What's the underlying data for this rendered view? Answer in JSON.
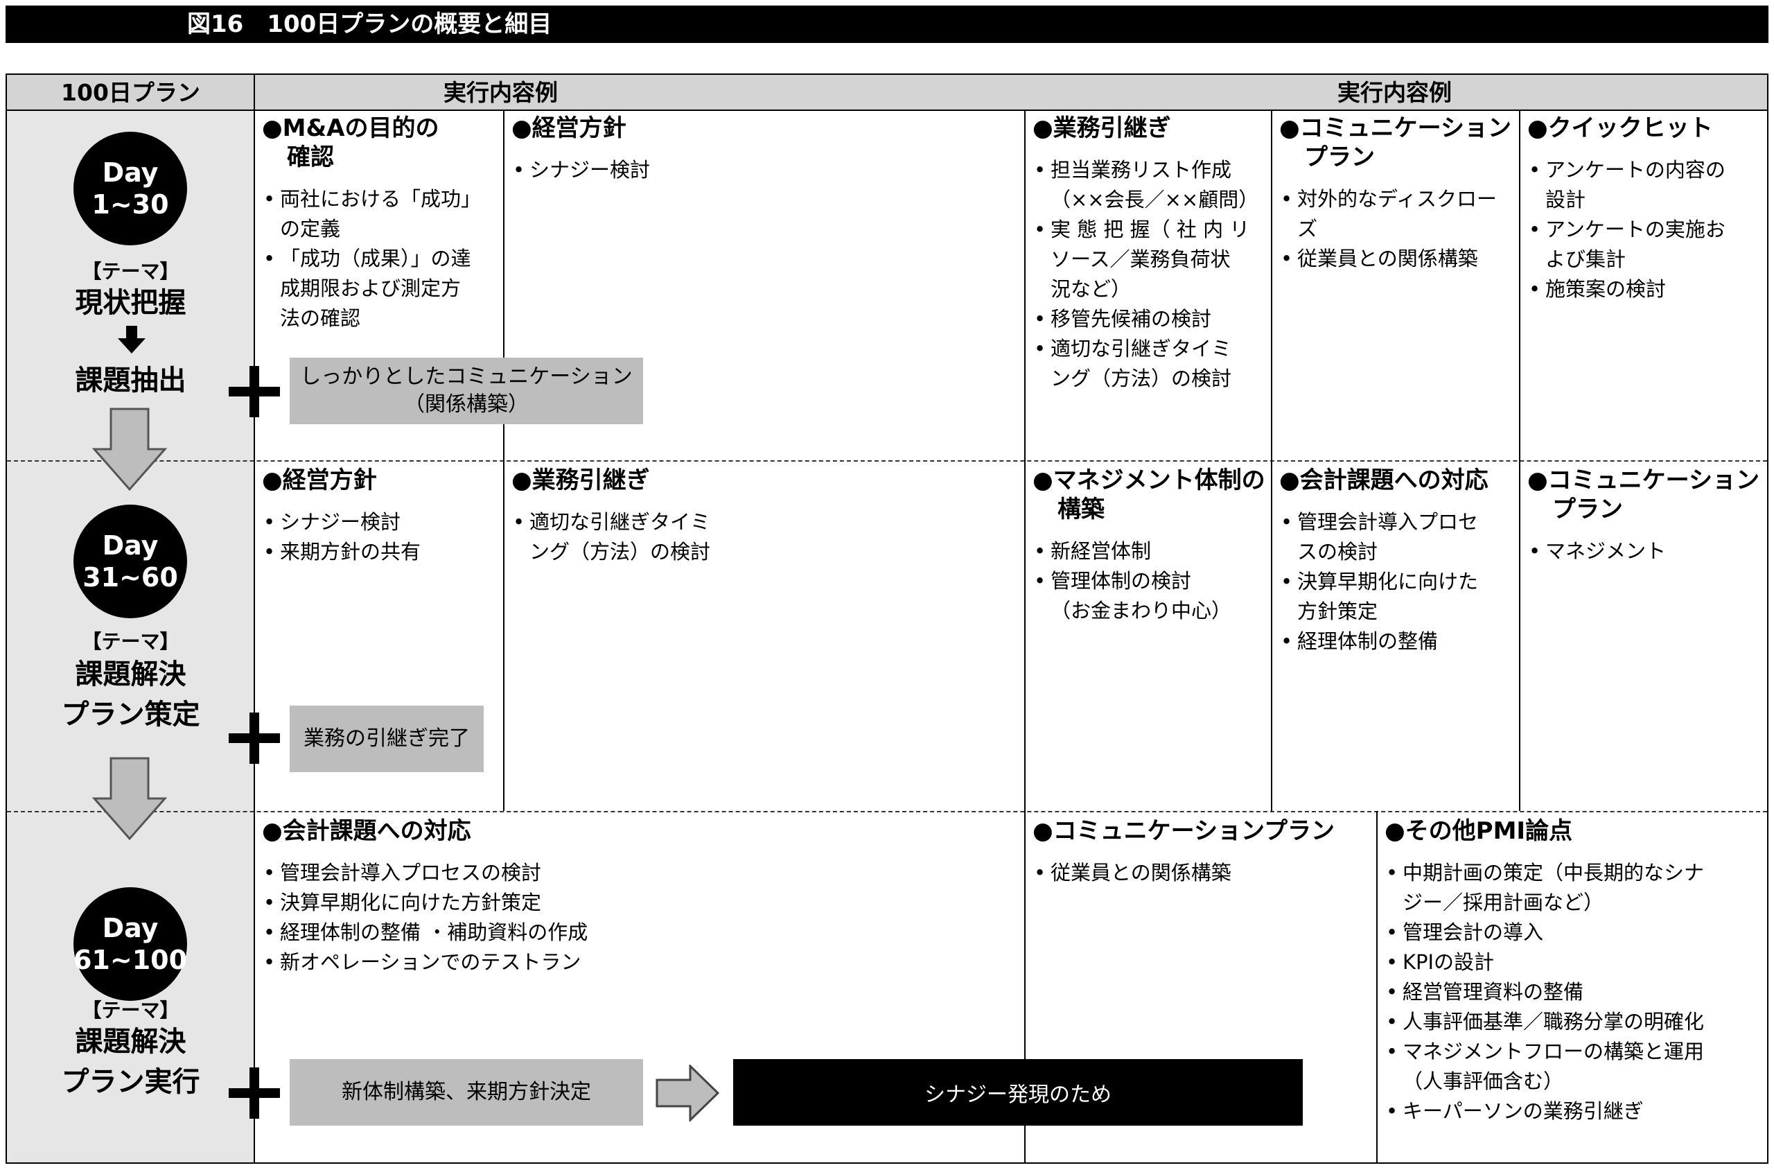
{
  "title": "図16　100日プランの概要と細目",
  "header": {
    "col_plan": "100日プラン",
    "col_exec1": "実行内容例",
    "col_exec2": "実行内容例"
  },
  "phases": [
    {
      "day_label": "Day",
      "day_range": "1~30",
      "theme_tag": "【テーマ】",
      "theme_line1": "現状把握",
      "theme_arrow": "↓",
      "theme_line2": "課題抽出",
      "box": [
        "しっかりとしたコミュニケーション",
        "（関係構築）"
      ]
    },
    {
      "day_label": "Day",
      "day_range": "31~60",
      "theme_tag": "【テーマ】",
      "theme_line1": "課題解決",
      "theme_line2": "プラン策定",
      "box": [
        "業務の引継ぎ完了"
      ]
    },
    {
      "day_label": "Day",
      "day_range": "61~100",
      "theme_tag": "【テーマ】",
      "theme_line1": "課題解決",
      "theme_line2": "プラン実行",
      "box": [
        "新体制構築、来期方針決定"
      ],
      "black_box": "シナジー発現のため"
    }
  ],
  "row1": {
    "c1": {
      "title": [
        "●M&Aの目的の",
        "確認"
      ],
      "items": [
        [
          "両社における「成功」",
          "の定義"
        ],
        [
          "「成功（成果）」の達",
          "成期限および測定方",
          "法の確認"
        ]
      ]
    },
    "c2": {
      "title": [
        "●経営方針"
      ],
      "items": [
        [
          "シナジー検討"
        ]
      ]
    },
    "c3": {
      "title": [
        "●業務引継ぎ"
      ],
      "items": [
        [
          "担当業務リスト作成",
          "（××会長／××顧問）"
        ],
        [
          "実 態 把 握（ 社 内 リ",
          "ソース／業務負荷状",
          "況など）"
        ],
        [
          "移管先候補の検討"
        ],
        [
          "適切な引継ぎタイミ",
          "ング（方法）の検討"
        ]
      ]
    },
    "c4": {
      "title": [
        "●コミュニケーション",
        "プラン"
      ],
      "items": [
        [
          "対外的なディスクロー",
          "ズ"
        ],
        [
          "従業員との関係構築"
        ]
      ]
    },
    "c5": {
      "title": [
        "●クイックヒット"
      ],
      "items": [
        [
          "アンケートの内容の",
          "設計"
        ],
        [
          "アンケートの実施お",
          "よび集計"
        ],
        [
          "施策案の検討"
        ]
      ]
    }
  },
  "row2": {
    "c1": {
      "title": [
        "●経営方針"
      ],
      "items": [
        [
          "シナジー検討"
        ],
        [
          "来期方針の共有"
        ]
      ]
    },
    "c2": {
      "title": [
        "●業務引継ぎ"
      ],
      "items": [
        [
          "適切な引継ぎタイミ",
          "ング（方法）の検討"
        ]
      ]
    },
    "c3": {
      "title": [
        "●マネジメント体制の",
        "構築"
      ],
      "items": [
        [
          "新経営体制"
        ],
        [
          "管理体制の検討",
          "（お金まわり中心）"
        ]
      ]
    },
    "c4": {
      "title": [
        "●会計課題への対応"
      ],
      "items": [
        [
          "管理会計導入プロセ",
          "スの検討"
        ],
        [
          "決算早期化に向けた",
          "方針策定"
        ],
        [
          "経理体制の整備"
        ]
      ]
    },
    "c5": {
      "title": [
        "●コミュニケーション",
        "プラン"
      ],
      "items": [
        [
          "マネジメント"
        ]
      ]
    }
  },
  "row3": {
    "c1": {
      "title": [
        "●会計課題への対応"
      ],
      "items": [
        [
          "管理会計導入プロセスの検討"
        ],
        [
          "決算早期化に向けた方針策定"
        ],
        [
          "経理体制の整備 ・補助資料の作成"
        ],
        [
          "新オペレーションでのテストラン"
        ]
      ]
    },
    "c2": {
      "title": [
        "●コミュニケーションプラン"
      ],
      "items": [
        [
          "従業員との関係構築"
        ]
      ]
    },
    "c3": {
      "title": [
        "●その他PMI論点"
      ],
      "items": [
        [
          "中期計画の策定（中長期的なシナ",
          "ジー／採用計画など）"
        ],
        [
          "管理会計の導入"
        ],
        [
          "KPIの設計"
        ],
        [
          "経営管理資料の整備"
        ],
        [
          "人事評価基準／職務分掌の明確化"
        ],
        [
          "マネジメントフローの構築と運用",
          "（人事評価含む）"
        ],
        [
          "キーパーソンの業務引継ぎ"
        ]
      ]
    }
  }
}
